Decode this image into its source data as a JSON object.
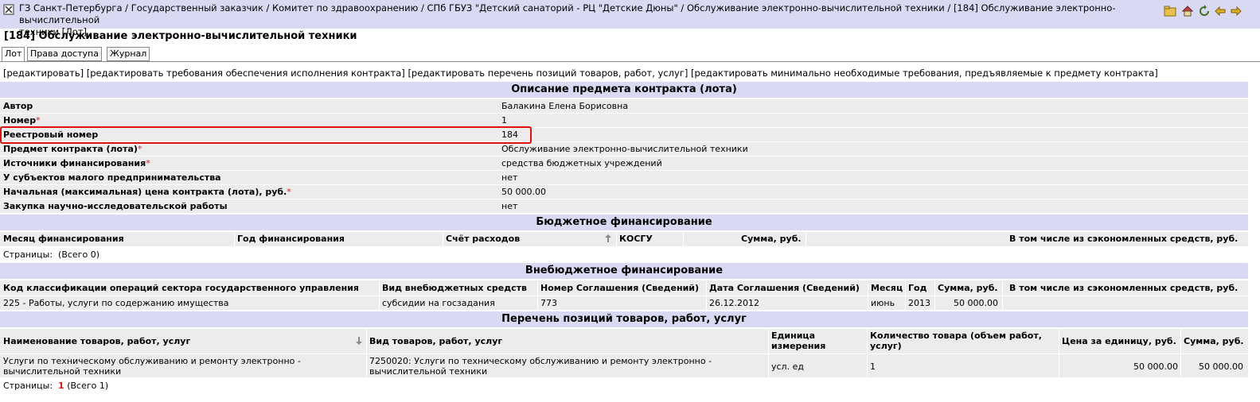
{
  "breadcrumb": {
    "line1": "ГЗ Санкт-Петербурга / Государственный заказчик / Комитет по здравоохранению / СПб ГБУЗ \"Детский санаторий - РЦ \"Детские Дюны\" / Обслуживание электронно-вычислительной техники / [184] Обслуживание электронно-вычислительной",
    "line2": "техники [Лот]"
  },
  "page_title": "[184] Обслуживание электронно-вычислительной техники",
  "tabs": [
    {
      "label": "Лот"
    },
    {
      "label": "Права доступа"
    },
    {
      "label": "Журнал"
    }
  ],
  "actions": {
    "edit": "[редактировать]",
    "edit_requirements": "[редактировать требования обеспечения исполнения контракта]",
    "edit_positions": "[редактировать перечень позиций товаров, работ, услуг]",
    "edit_min_requirements": "[редактировать минимально необходимые требования, предъявляемые к предмету контракта]"
  },
  "description": {
    "title": "Описание предмета контракта (лота)",
    "fields": [
      {
        "label": "Автор",
        "value": "Балакина Елена Борисовна",
        "required": ""
      },
      {
        "label": "Номер",
        "value": "1",
        "required": "*"
      },
      {
        "label": "Реестровый номер",
        "value": "184",
        "required": ""
      },
      {
        "label": "Предмет контракта (лота)",
        "value": "Обслуживание электронно-вычислительной техники",
        "required": "*"
      },
      {
        "label": "Источники финансирования",
        "value": "средства бюджетных учреждений",
        "required": "*"
      },
      {
        "label": "У субъектов малого предпринимательства",
        "value": "нет",
        "required": ""
      },
      {
        "label": "Начальная (максимальная) цена контракта (лота), руб.",
        "value": "50 000.00",
        "required": "*"
      },
      {
        "label": "Закупка научно-исследовательской работы",
        "value": "нет",
        "required": ""
      }
    ]
  },
  "budget": {
    "title": "Бюджетное финансирование",
    "columns": [
      "Месяц финансирования",
      "Год финансирования",
      "Счёт расходов",
      "КОСГУ",
      "Сумма, руб.",
      "В том числе из сэкономленных средств, руб."
    ],
    "pages_label": "Страницы:",
    "pages_total": "(Всего 0)"
  },
  "offbudget": {
    "title": "Внебюджетное финансирование",
    "columns": [
      "Код классификации операций сектора государственного управления",
      "Вид внебюджетных средств",
      "Номер Соглашения (Сведений)",
      "Дата Соглашения (Сведений)",
      "Месяц",
      "Год",
      "Сумма, руб.",
      "В том числе из сэкономленных средств, руб."
    ],
    "row": [
      "225 - Работы, услуги по содержанию имущества",
      "субсидии на госзадания",
      "773",
      "26.12.2012",
      "июнь",
      "2013",
      "50 000.00",
      ""
    ]
  },
  "positions": {
    "title": "Перечень позиций товаров, работ, услуг",
    "columns": [
      "Наименование товаров, работ, услуг",
      "Вид товаров, работ, услуг",
      "Единица измерения",
      "Количество товара (объем работ, услуг)",
      "Цена за единицу, руб.",
      "Сумма, руб."
    ],
    "row": {
      "name_l1": "Услуги по техническому обслуживанию и ремонту электронно -",
      "name_l2": "вычислительной техники",
      "kind_l1": "7250020: Услуги по техническому обслуживанию и ремонту электронно -",
      "kind_l2": "вычислительной техники",
      "unit": "усл. ед",
      "qty": "1",
      "price": "50 000.00",
      "sum": "50 000.00"
    },
    "pages_label": "Страницы:",
    "pages_current": "1",
    "pages_total": "(Всего 1)"
  },
  "colors": {
    "header_bg": "#d9d9f3",
    "row_bg": "#ececec",
    "highlight": "#e01010",
    "required": "#e02020"
  }
}
